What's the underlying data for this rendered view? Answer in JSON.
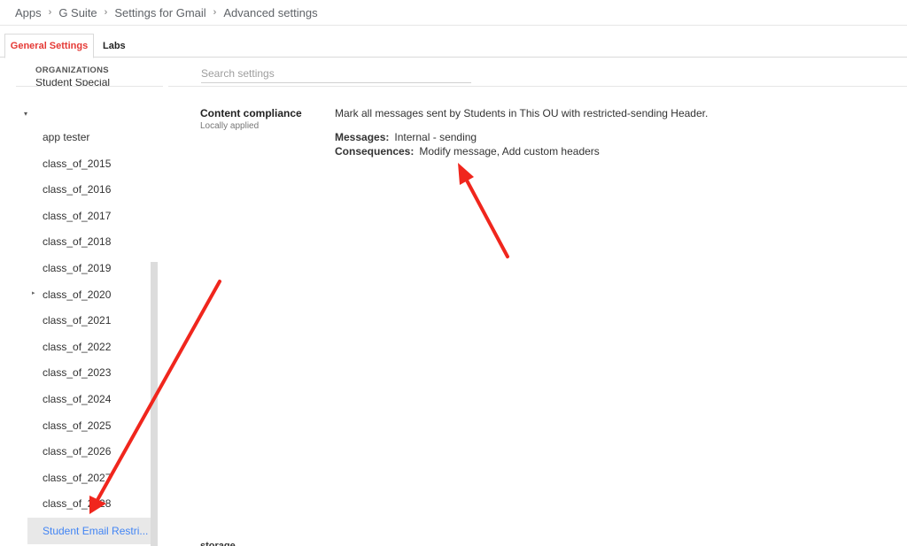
{
  "breadcrumb": [
    "Apps",
    "G Suite",
    "Settings for Gmail",
    "Advanced settings"
  ],
  "breadcrumb_separator": "›",
  "tabs": [
    {
      "label": "General Settings",
      "active": true
    },
    {
      "label": "Labs",
      "active": false
    }
  ],
  "sidebar": {
    "header": "ORGANIZATIONS",
    "cutoff_item": "Student Special",
    "caret": "▾",
    "items": [
      {
        "label": "app tester"
      },
      {
        "label": "class_of_2015"
      },
      {
        "label": "class_of_2016"
      },
      {
        "label": "class_of_2017"
      },
      {
        "label": "class_of_2018"
      },
      {
        "label": "class_of_2019"
      },
      {
        "label": "class_of_2020",
        "expandable": true,
        "expander": "▸"
      },
      {
        "label": "class_of_2021"
      },
      {
        "label": "class_of_2022"
      },
      {
        "label": "class_of_2023"
      },
      {
        "label": "class_of_2024"
      },
      {
        "label": "class_of_2025"
      },
      {
        "label": "class_of_2026"
      },
      {
        "label": "class_of_2027"
      },
      {
        "label": "class_of_2028"
      }
    ],
    "selected_item": "Student Email Restri..."
  },
  "search": {
    "placeholder": "Search settings",
    "value": ""
  },
  "setting": {
    "title": "Content compliance",
    "subtitle": "Locally applied",
    "description": "Mark all messages sent by Students in This OU with restricted-sending Header.",
    "messages_label": "Messages:",
    "messages_value": "Internal - sending",
    "consequences_label": "Consequences:",
    "consequences_value": "Modify message, Add custom headers"
  },
  "bottom_cut_text": "storage",
  "colors": {
    "accent_red": "#e53935",
    "link_blue": "#4285f4",
    "annotation_red": "#f0261d"
  }
}
